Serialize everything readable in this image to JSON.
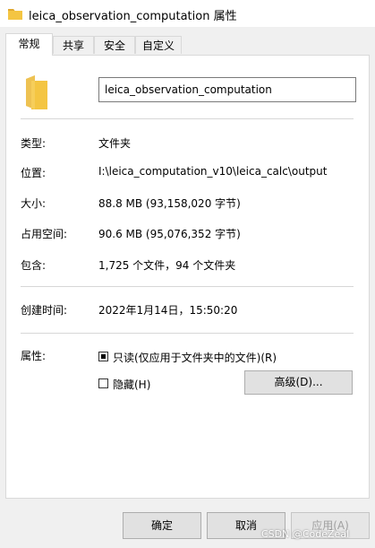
{
  "window": {
    "title": "leica_observation_computation 属性"
  },
  "tabs": [
    {
      "label": "常规",
      "active": true
    },
    {
      "label": "共享",
      "active": false
    },
    {
      "label": "安全",
      "active": false
    },
    {
      "label": "自定义",
      "active": false
    }
  ],
  "general": {
    "name_value": "leica_observation_computation",
    "type_label": "类型:",
    "type_value": "文件夹",
    "location_label": "位置:",
    "location_value": "I:\\leica_computation_v10\\leica_calc\\output",
    "size_label": "大小:",
    "size_value": "88.8 MB (93,158,020 字节)",
    "size_on_disk_label": "占用空间:",
    "size_on_disk_value": "90.6 MB (95,076,352 字节)",
    "contains_label": "包含:",
    "contains_value": "1,725 个文件，94 个文件夹",
    "created_label": "创建时间:",
    "created_value": "2022年1月14日，15:50:20",
    "attributes_label": "属性:",
    "readonly_label": "只读(仅应用于文件夹中的文件)(R)",
    "readonly_checked": true,
    "hidden_label": "隐藏(H)",
    "hidden_checked": false,
    "advanced_label": "高级(D)..."
  },
  "buttons": {
    "ok": "确定",
    "cancel": "取消",
    "apply": "应用(A)"
  },
  "watermark": "CSDN @CodeZeal",
  "colors": {
    "folder": "#f4c542",
    "folder_dark": "#e0a82e"
  }
}
